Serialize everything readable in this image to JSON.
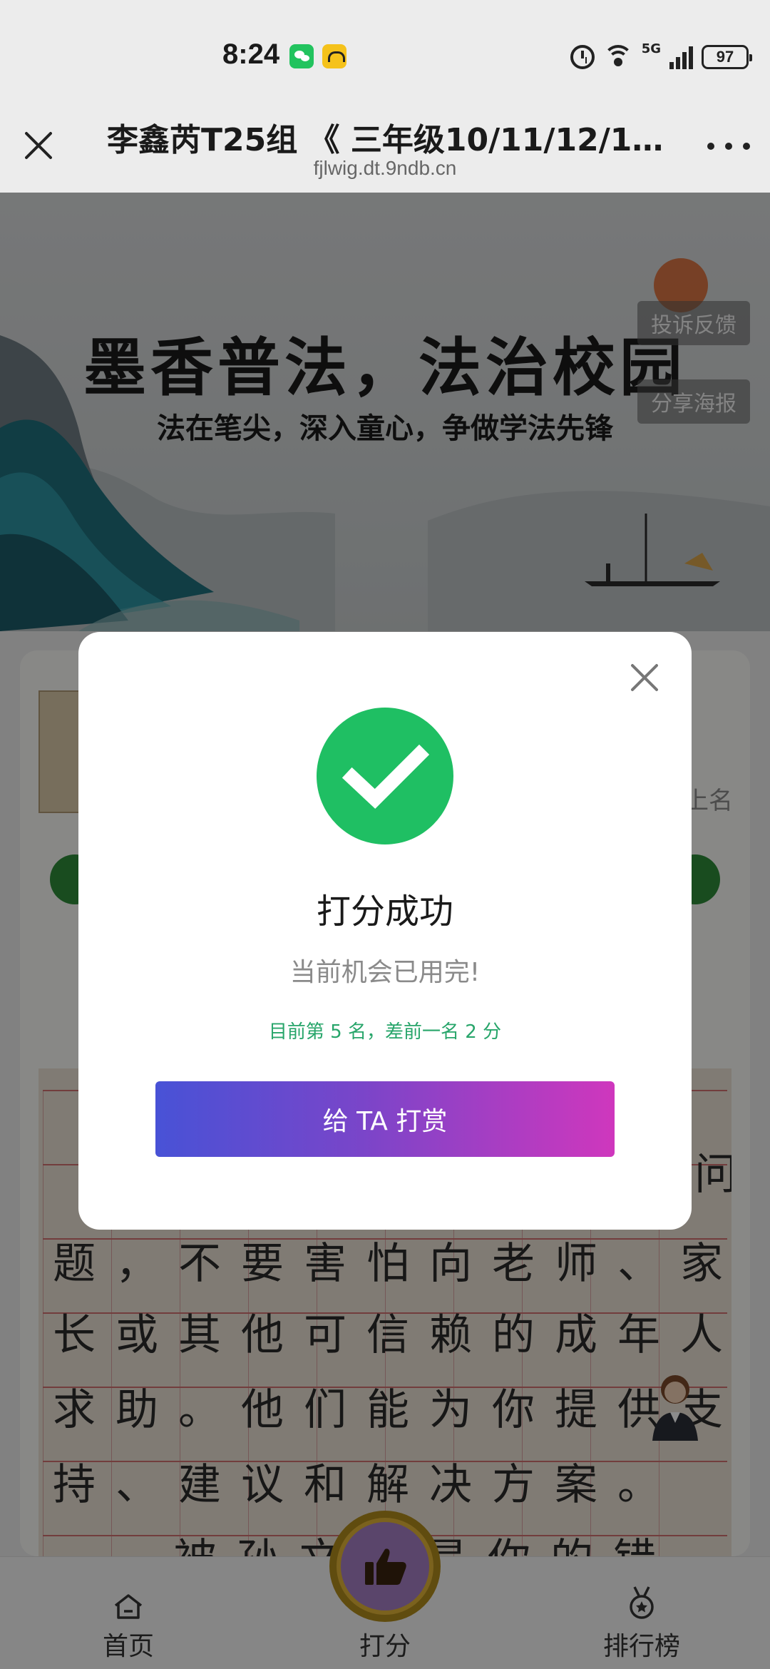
{
  "status_bar": {
    "time": "8:24",
    "network": "5G",
    "signal_label": "6",
    "battery": "97"
  },
  "title_bar": {
    "title": "李鑫芮T25组 《 三年级10/11/12/13…",
    "url": "fjlwig.dt.9ndb.cn"
  },
  "banner": {
    "title": "墨香普法，法治校园",
    "subtitle": "法在笔尖，深入童心，争做学法先锋",
    "report_button": "投诉反馈",
    "share_button": "分享海报"
  },
  "content": {
    "rank_label": "上名",
    "essay_lines": [
      "问",
      "题，不要害怕向老师、家",
      "长或其他可信赖的成年人",
      "求助。他们能为你提供支",
      "持、建议和解决方案。",
      "被孙文不是你的错"
    ]
  },
  "modal": {
    "title": "打分成功",
    "message": "当前机会已用完!",
    "rank_text": "目前第 5 名，差前一名 2 分",
    "reward_button": "给 TA 打赏"
  },
  "bottom_nav": {
    "home": "首页",
    "score": "打分",
    "rank": "排行榜"
  },
  "colors": {
    "success": "#1fbf63",
    "rank_text": "#27a56a",
    "button_gradient_start": "#4852d6",
    "button_gradient_end": "#cf37bd"
  }
}
